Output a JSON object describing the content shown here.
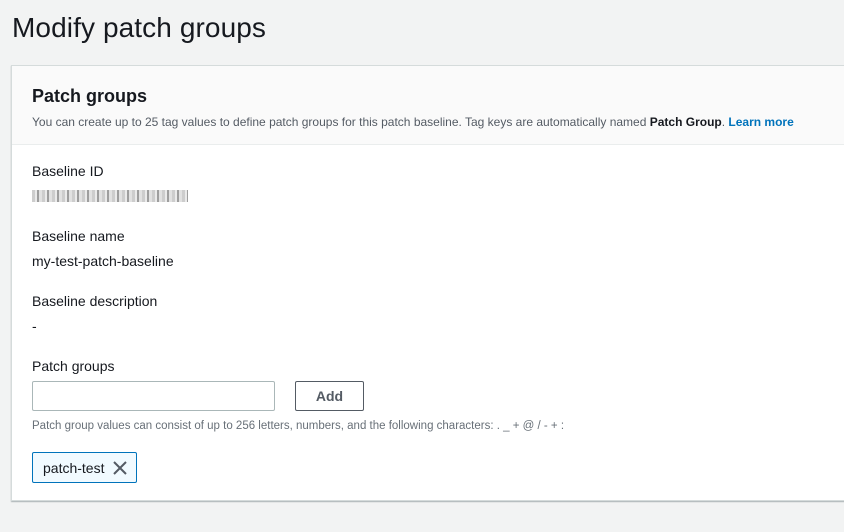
{
  "page": {
    "title": "Modify patch groups"
  },
  "panel": {
    "title": "Patch groups",
    "description_prefix": "You can create up to 25 tag values to define patch groups for this patch baseline. Tag keys are automatically named ",
    "description_bold": "Patch Group",
    "description_suffix": ". ",
    "learn_more": "Learn more"
  },
  "fields": {
    "baseline_id": {
      "label": "Baseline ID"
    },
    "baseline_name": {
      "label": "Baseline name",
      "value": "my-test-patch-baseline"
    },
    "baseline_description": {
      "label": "Baseline description",
      "value": "-"
    },
    "patch_groups": {
      "label": "Patch groups",
      "input_value": "",
      "add_label": "Add",
      "constraint": "Patch group values can consist of up to 256 letters, numbers, and the following characters: . _ + @ / - + :",
      "tokens": [
        {
          "label": "patch-test",
          "icon": "close-icon"
        }
      ]
    }
  },
  "colors": {
    "link": "#0073bb",
    "token_border": "#0073bb",
    "token_bg": "#f1faff"
  }
}
